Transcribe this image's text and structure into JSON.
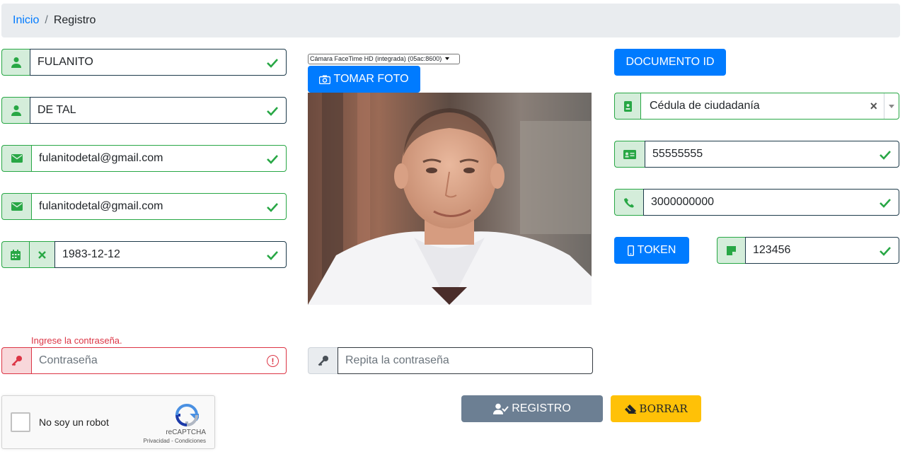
{
  "breadcrumb": {
    "home": "Inicio",
    "separator": "/",
    "current": "Registro"
  },
  "form": {
    "first_name": "FULANITO",
    "last_name": "DE TAL",
    "email": "fulanitodetal@gmail.com",
    "email_confirm": "fulanitodetal@gmail.com",
    "birthdate": "1983-12-12",
    "camera_label": "Cámara FaceTime HD (integrada) (05ac:8600)",
    "take_photo": "TOMAR FOTO",
    "document_id_button": "DOCUMENTO ID",
    "document_type": "Cédula de ciudadanía",
    "document_number": "55555555",
    "phone": "3000000000",
    "token_button": "TOKEN",
    "token_value": "123456",
    "password_error": "Ingrese la contraseña.",
    "password_placeholder": "Contraseña",
    "password_repeat_placeholder": "Repita la contraseña",
    "register_button": "REGISTRO",
    "clear_button": "BORRAR"
  },
  "captcha": {
    "label": "No soy un robot",
    "brand": "reCAPTCHA",
    "terms": "Privacidad - Condiciones"
  },
  "colors": {
    "primary": "#007bff",
    "success": "#28a745",
    "danger": "#dc3545",
    "warning": "#ffc107",
    "secondary": "#6c7f93"
  }
}
